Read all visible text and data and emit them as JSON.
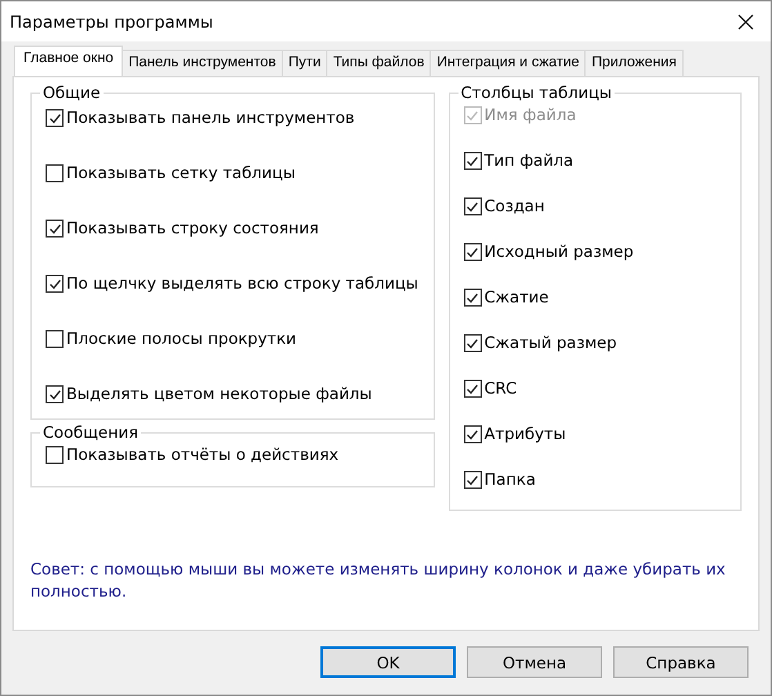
{
  "window": {
    "title": "Параметры программы"
  },
  "tabs": [
    {
      "label": "Главное окно",
      "selected": true
    },
    {
      "label": "Панель инструментов",
      "selected": false
    },
    {
      "label": "Пути",
      "selected": false
    },
    {
      "label": "Типы файлов",
      "selected": false
    },
    {
      "label": "Интеграция и сжатие",
      "selected": false
    },
    {
      "label": "Приложения",
      "selected": false
    }
  ],
  "general": {
    "title": "Общие",
    "options": [
      {
        "label": "Показывать панель инструментов",
        "checked": true
      },
      {
        "label": "Показывать сетку таблицы",
        "checked": false
      },
      {
        "label": "Показывать строку состояния",
        "checked": true
      },
      {
        "label": "По щелчку выделять всю строку таблицы",
        "checked": true
      },
      {
        "label": "Плоские полосы прокрутки",
        "checked": false
      },
      {
        "label": "Выделять цветом некоторые файлы",
        "checked": true
      }
    ]
  },
  "messages": {
    "title": "Сообщения",
    "options": [
      {
        "label": "Показывать отчёты о действиях",
        "checked": false
      }
    ]
  },
  "columns": {
    "title": "Столбцы таблицы",
    "options": [
      {
        "label": "Имя файла",
        "checked": true,
        "disabled": true
      },
      {
        "label": "Тип файла",
        "checked": true,
        "disabled": false
      },
      {
        "label": "Создан",
        "checked": true,
        "disabled": false
      },
      {
        "label": "Исходный размер",
        "checked": true,
        "disabled": false
      },
      {
        "label": "Сжатие",
        "checked": true,
        "disabled": false
      },
      {
        "label": "Сжатый размер",
        "checked": true,
        "disabled": false
      },
      {
        "label": "CRC",
        "checked": true,
        "disabled": false
      },
      {
        "label": "Атрибуты",
        "checked": true,
        "disabled": false
      },
      {
        "label": "Папка",
        "checked": true,
        "disabled": false
      }
    ]
  },
  "hint": "Совет: с помощью мыши вы можете изменять ширину колонок и даже убирать их полностью.",
  "buttons": [
    {
      "label": "OK",
      "default": true
    },
    {
      "label": "Отмена",
      "default": false
    },
    {
      "label": "Справка",
      "default": false
    }
  ]
}
